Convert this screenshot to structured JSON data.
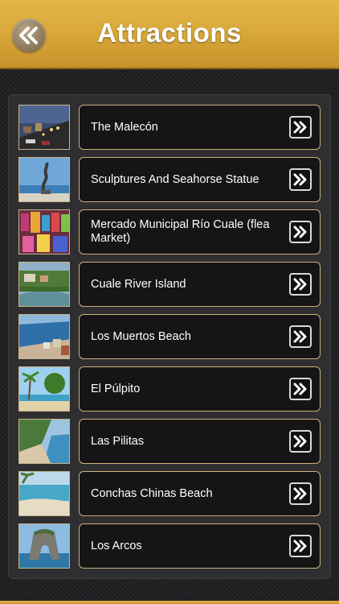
{
  "header": {
    "title": "Attractions",
    "back_icon": "double-chevron-left-icon",
    "color": "#d9a93b"
  },
  "list": {
    "items": [
      {
        "label": "The Malecón",
        "thumb": "city-street"
      },
      {
        "label": "Sculptures And Seahorse Statue",
        "thumb": "seahorse-statue"
      },
      {
        "label": "Mercado Municipal Río Cuale (flea Market)",
        "thumb": "market-stalls"
      },
      {
        "label": "Cuale River Island",
        "thumb": "river"
      },
      {
        "label": "Los Muertos Beach",
        "thumb": "beach-aerial"
      },
      {
        "label": "El Púlpito",
        "thumb": "palm-beach"
      },
      {
        "label": "Las Pilitas",
        "thumb": "coast"
      },
      {
        "label": "Conchas Chinas Beach",
        "thumb": "cove"
      },
      {
        "label": "Los Arcos",
        "thumb": "rock-arch"
      }
    ],
    "arrow_icon": "double-chevron-right-icon"
  }
}
